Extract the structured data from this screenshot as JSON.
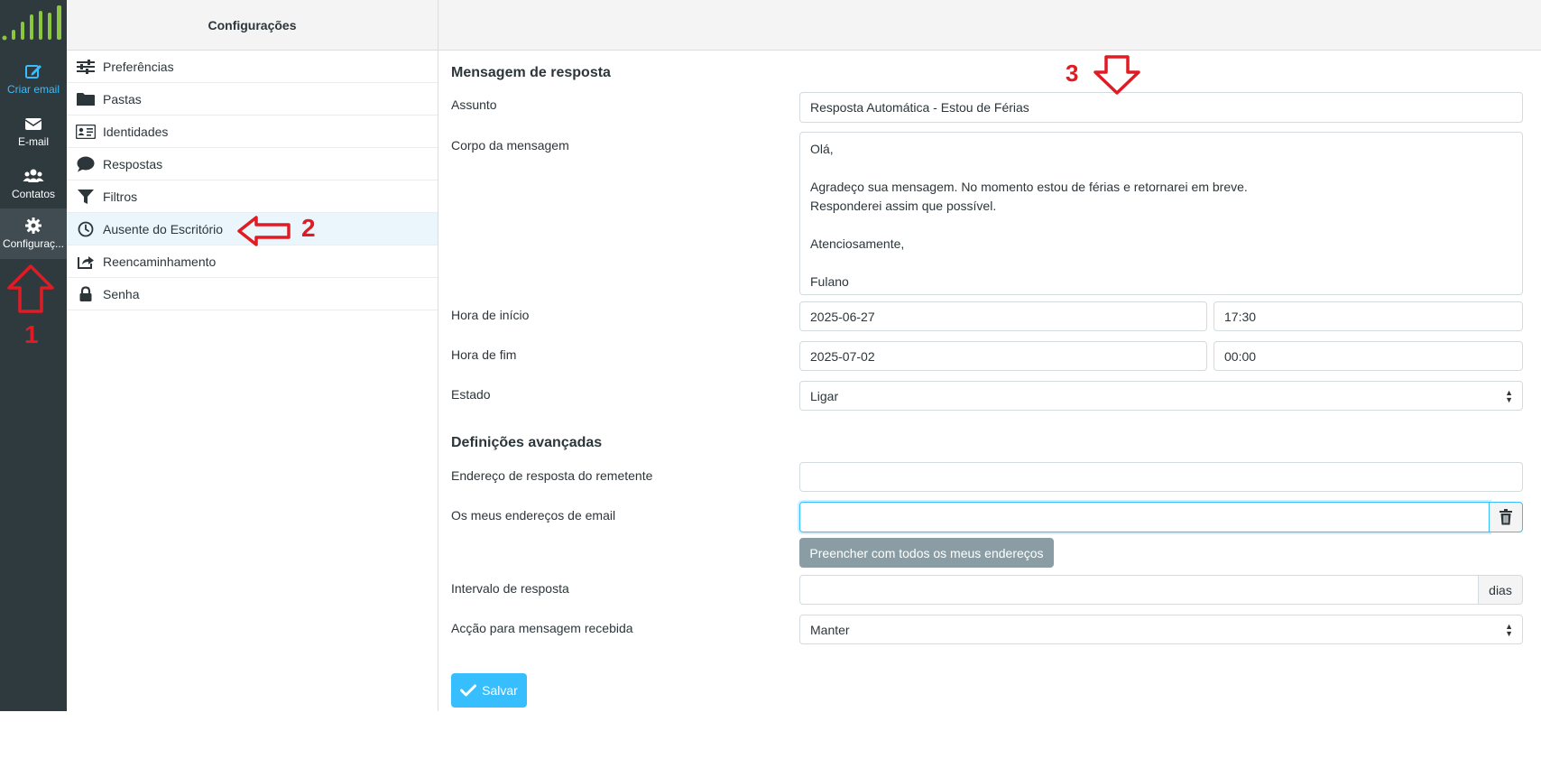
{
  "taskmenu": {
    "items": [
      {
        "label": "Criar email",
        "icon": "compose-icon"
      },
      {
        "label": "E-mail",
        "icon": "envelope-icon"
      },
      {
        "label": "Contatos",
        "icon": "contacts-icon"
      },
      {
        "label": "Configuraç...",
        "icon": "gear-icon"
      }
    ]
  },
  "settings": {
    "title": "Configurações",
    "items": [
      {
        "label": "Preferências",
        "icon": "sliders-icon"
      },
      {
        "label": "Pastas",
        "icon": "folder-icon"
      },
      {
        "label": "Identidades",
        "icon": "id-card-icon"
      },
      {
        "label": "Respostas",
        "icon": "comment-icon"
      },
      {
        "label": "Filtros",
        "icon": "filter-icon"
      },
      {
        "label": "Ausente do Escritório",
        "icon": "clock-icon"
      },
      {
        "label": "Reencaminhamento",
        "icon": "forward-icon"
      },
      {
        "label": "Senha",
        "icon": "lock-icon"
      }
    ]
  },
  "form": {
    "section_response": "Mensagem de resposta",
    "subject_label": "Assunto",
    "subject_value": "Resposta Automática - Estou de Férias",
    "body_label": "Corpo da mensagem",
    "body_value": "Olá,\n\nAgradeço sua mensagem. No momento estou de férias e retornarei em breve.\nResponderei assim que possível.\n\nAtenciosamente,\n\nFulano",
    "start_label": "Hora de início",
    "start_date": "2025-06-27",
    "start_time": "17:30",
    "end_label": "Hora de fim",
    "end_date": "2025-07-02",
    "end_time": "00:00",
    "status_label": "Estado",
    "status_value": "Ligar",
    "section_advanced": "Definições avançadas",
    "sender_label": "Endereço de resposta do remetente",
    "sender_value": "",
    "my_emails_label": "Os meus endereços de email",
    "my_emails_value": "",
    "fill_button": "Preencher com todos os meus endereços",
    "interval_label": "Intervalo de resposta",
    "interval_value": "",
    "interval_unit": "dias",
    "action_label": "Acção para mensagem recebida",
    "action_value": "Manter",
    "save_button": "Salvar"
  },
  "annotations": [
    "1",
    "2",
    "3"
  ],
  "colors": {
    "accent": "#37beff",
    "sidebar": "#2f3a3f",
    "annotation": "#e01b24",
    "logo": "#8cc63f"
  }
}
